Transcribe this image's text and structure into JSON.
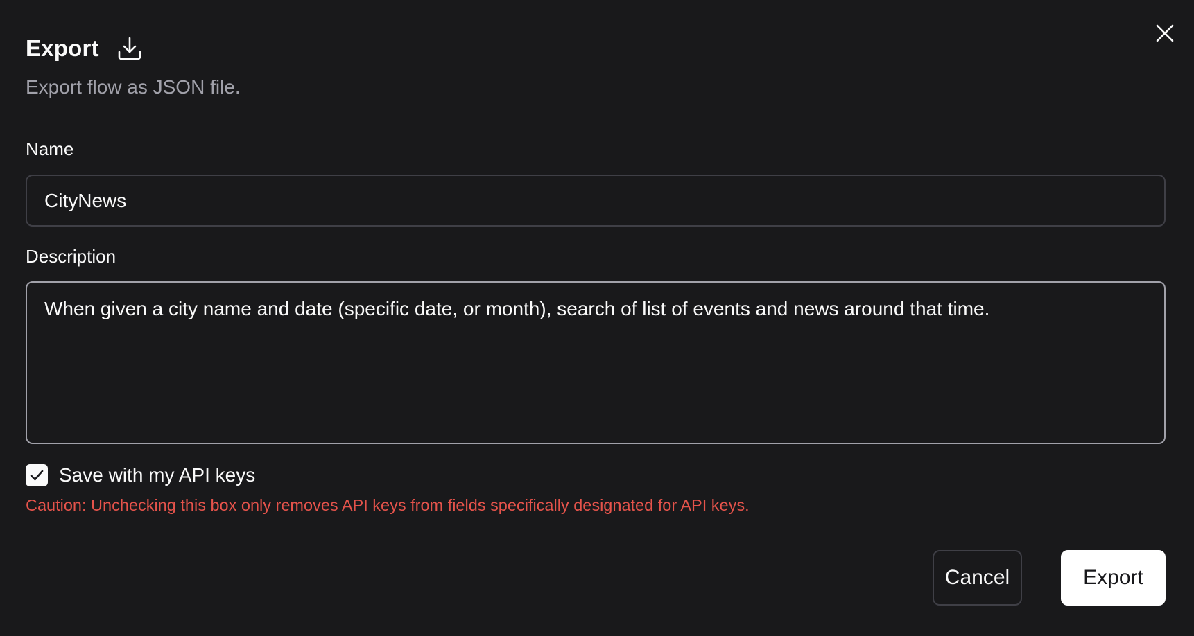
{
  "dialog": {
    "title": "Export",
    "title_icon": "download-icon",
    "subtitle": "Export flow as JSON file.",
    "close_icon": "close-icon"
  },
  "form": {
    "name_label": "Name",
    "name_value": "CityNews",
    "description_label": "Description",
    "description_value": "When given a city name and date (specific date, or month), search of list of events and news around that time.",
    "save_api_keys_label": "Save with my API keys",
    "save_api_keys_checked": true,
    "caution_text": "Caution: Unchecking this box only removes API keys from fields specifically designated for API keys."
  },
  "actions": {
    "cancel_label": "Cancel",
    "export_label": "Export"
  },
  "colors": {
    "background": "#19191b",
    "caution": "#e5534b",
    "primary_button_bg": "#ffffff",
    "primary_button_text": "#18181b"
  }
}
